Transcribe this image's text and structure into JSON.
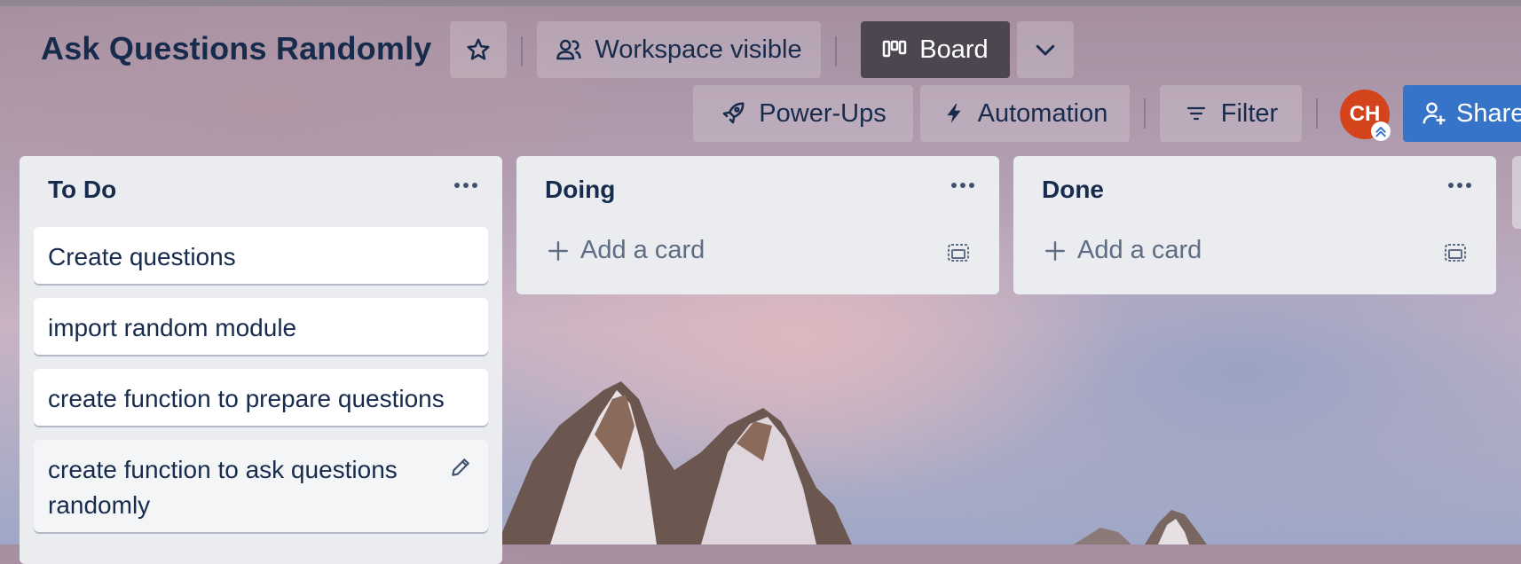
{
  "board": {
    "title": "Ask Questions Randomly",
    "visibility_label": "Workspace visible",
    "view_label": "Board"
  },
  "toolbar": {
    "powerups_label": "Power-Ups",
    "automation_label": "Automation",
    "filter_label": "Filter",
    "share_label": "Share",
    "avatar_initials": "CH"
  },
  "lists": [
    {
      "title": "To Do",
      "cards": [
        "Create questions",
        "import random module",
        "create function to prepare questions",
        "create function to ask questions randomly"
      ]
    },
    {
      "title": "Doing",
      "add_card_label": "Add a card"
    },
    {
      "title": "Done",
      "add_card_label": "Add a card"
    }
  ],
  "colors": {
    "board_button": "#4b4650",
    "share_button": "#3574c8",
    "avatar": "#d4441c",
    "list_background": "#ebecf0"
  }
}
